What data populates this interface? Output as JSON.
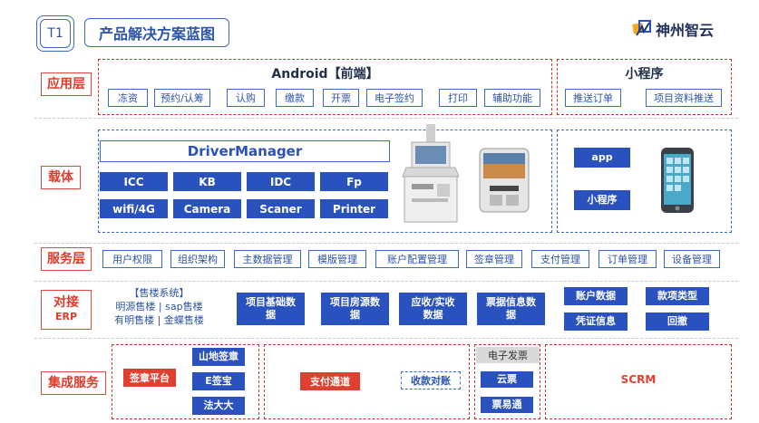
{
  "header": {
    "tag": "T1",
    "title": "产品解决方案蓝图",
    "logo_text": "神州智云"
  },
  "layers": {
    "app": "应用层",
    "carrier": "载体",
    "service": "服务层",
    "erp": "对接\nERP",
    "integration": "集成服务"
  },
  "app_layer": {
    "android_title": "Android【前端】",
    "android_items": [
      "冻资",
      "预约/认筹",
      "认购",
      "缴款",
      "开票",
      "电子签约",
      "打印",
      "辅助功能"
    ],
    "mini_title": "小程序",
    "mini_items": [
      "推送订单",
      "项目资料推送"
    ]
  },
  "carrier_layer": {
    "driver_manager": "DriverManager",
    "drivers": [
      "ICC",
      "KB",
      "IDC",
      "Fp",
      "wifi/4G",
      "Camera",
      "Scaner",
      "Printer"
    ],
    "mobile": [
      "app",
      "小程序"
    ]
  },
  "service_layer": {
    "items": [
      "用户权限",
      "组织架构",
      "主数据管理",
      "模版管理",
      "账户配置管理",
      "签章管理",
      "支付管理",
      "订单管理",
      "设备管理"
    ]
  },
  "erp_layer": {
    "systems_title": "【售楼系统】",
    "systems_line1": "明源售楼 | sap售楼",
    "systems_line2": "有明售楼 | 金蝶售楼",
    "items": [
      "项目基础数\n据",
      "项目房源数\n据",
      "应收/实收\n数据",
      "票据信息数\n据"
    ],
    "right_items": [
      "账户数据",
      "款项类型",
      "凭证信息",
      "回撤"
    ]
  },
  "integration_layer": {
    "sign_platform": "签章平台",
    "sign_vendors": [
      "山地签章",
      "E签宝",
      "法大大"
    ],
    "payment": "支付通道",
    "reconcile": "收款对账",
    "invoice_title": "电子发票",
    "invoice_vendors": [
      "云票",
      "票易通"
    ],
    "scrm": "SCRM"
  },
  "colors": {
    "blue": "#2a52be",
    "red": "#e0402f",
    "logo_orange": "#f5a623"
  }
}
